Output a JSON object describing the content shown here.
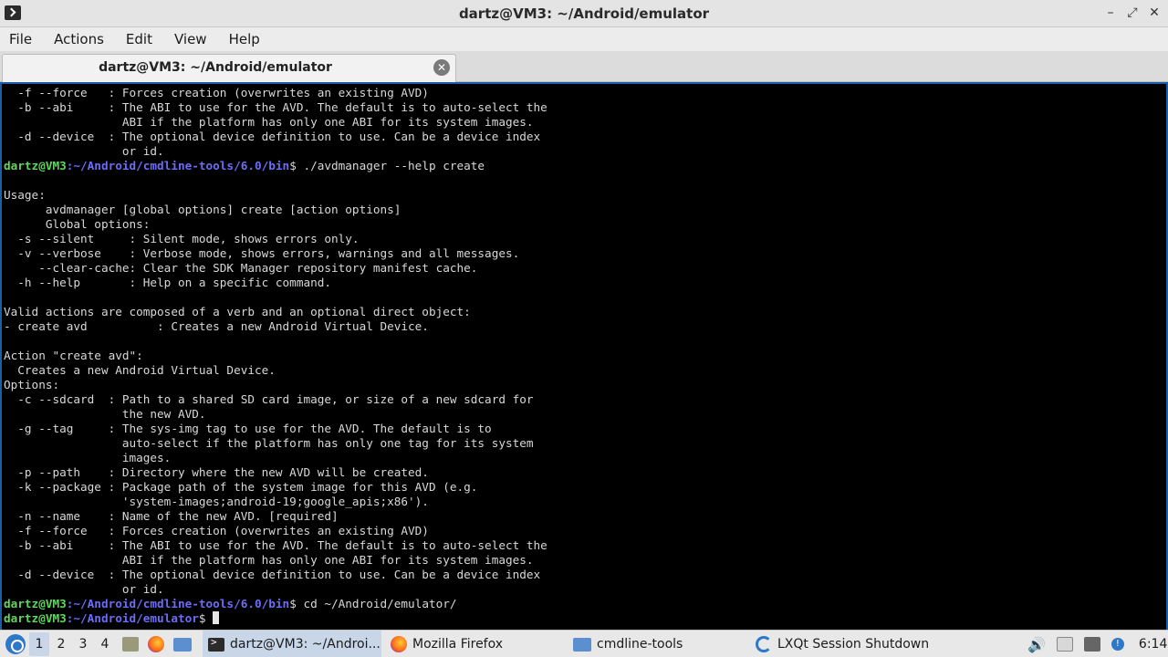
{
  "window": {
    "title": "dartz@VM3: ~/Android/emulator",
    "controls": {
      "minimize": "–",
      "maximize": "⤢",
      "close": "✕"
    }
  },
  "menubar": [
    "File",
    "Actions",
    "Edit",
    "View",
    "Help"
  ],
  "tab": {
    "label": "dartz@VM3: ~/Android/emulator",
    "close": "✕"
  },
  "terminal": {
    "lines": [
      {
        "t": "  -f --force   : Forces creation (overwrites an existing AVD)"
      },
      {
        "t": "  -b --abi     : The ABI to use for the AVD. The default is to auto-select the"
      },
      {
        "t": "                 ABI if the platform has only one ABI for its system images."
      },
      {
        "t": "  -d --device  : The optional device definition to use. Can be a device index"
      },
      {
        "t": "                 or id."
      },
      {
        "u": "dartz@VM3",
        "p": ":~/Android/cmdline-tools/6.0/bin",
        "t": "$ ./avdmanager --help create"
      },
      {
        "t": ""
      },
      {
        "t": "Usage:"
      },
      {
        "t": "      avdmanager [global options] create [action options]"
      },
      {
        "t": "      Global options:"
      },
      {
        "t": "  -s --silent     : Silent mode, shows errors only."
      },
      {
        "t": "  -v --verbose    : Verbose mode, shows errors, warnings and all messages."
      },
      {
        "t": "     --clear-cache: Clear the SDK Manager repository manifest cache."
      },
      {
        "t": "  -h --help       : Help on a specific command."
      },
      {
        "t": ""
      },
      {
        "t": "Valid actions are composed of a verb and an optional direct object:"
      },
      {
        "t": "- create avd          : Creates a new Android Virtual Device."
      },
      {
        "t": ""
      },
      {
        "t": "Action \"create avd\":"
      },
      {
        "t": "  Creates a new Android Virtual Device."
      },
      {
        "t": "Options:"
      },
      {
        "t": "  -c --sdcard  : Path to a shared SD card image, or size of a new sdcard for"
      },
      {
        "t": "                 the new AVD."
      },
      {
        "t": "  -g --tag     : The sys-img tag to use for the AVD. The default is to"
      },
      {
        "t": "                 auto-select if the platform has only one tag for its system"
      },
      {
        "t": "                 images."
      },
      {
        "t": "  -p --path    : Directory where the new AVD will be created."
      },
      {
        "t": "  -k --package : Package path of the system image for this AVD (e.g."
      },
      {
        "t": "                 'system-images;android-19;google_apis;x86')."
      },
      {
        "t": "  -n --name    : Name of the new AVD. [required]"
      },
      {
        "t": "  -f --force   : Forces creation (overwrites an existing AVD)"
      },
      {
        "t": "  -b --abi     : The ABI to use for the AVD. The default is to auto-select the"
      },
      {
        "t": "                 ABI if the platform has only one ABI for its system images."
      },
      {
        "t": "  -d --device  : The optional device definition to use. Can be a device index"
      },
      {
        "t": "                 or id."
      },
      {
        "u": "dartz@VM3",
        "p": ":~/Android/cmdline-tools/6.0/bin",
        "t": "$ cd ~/Android/emulator/"
      },
      {
        "u": "dartz@VM3",
        "p": ":~/Android/emulator",
        "t": "$ ",
        "cursor": true
      }
    ]
  },
  "taskbar": {
    "desktops": [
      "1",
      "2",
      "3",
      "4"
    ],
    "active_desktop": "1",
    "tasks": [
      {
        "icon": "terminal-icon",
        "label": "dartz@VM3: ~/Androi..."
      },
      {
        "icon": "firefox-icon",
        "label": "Mozilla Firefox"
      },
      {
        "icon": "folder-icon",
        "label": "cmdline-tools"
      },
      {
        "icon": "lxqt-icon",
        "label": "LXQt Session Shutdown"
      }
    ],
    "clock": "6:14",
    "colors": {
      "accent": "#2f78c8",
      "prompt_user": "#5fd75f",
      "prompt_path": "#6c6cf5"
    }
  }
}
